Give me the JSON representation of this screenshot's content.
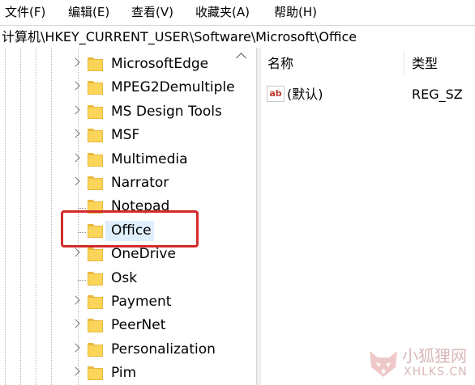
{
  "menu": [
    "文件(F)",
    "编辑(E)",
    "查看(V)",
    "收藏夹(A)",
    "帮助(H)"
  ],
  "address": "计算机\\HKEY_CURRENT_USER\\Software\\Microsoft\\Office",
  "tree": {
    "items": [
      {
        "label": "MicrosoftEdge",
        "expandable": true
      },
      {
        "label": "MPEG2Demultiple",
        "expandable": true
      },
      {
        "label": "MS Design Tools",
        "expandable": true
      },
      {
        "label": "MSF",
        "expandable": true
      },
      {
        "label": "Multimedia",
        "expandable": true
      },
      {
        "label": "Narrator",
        "expandable": true
      },
      {
        "label": "Notepad",
        "expandable": false
      },
      {
        "label": "Office",
        "expandable": false,
        "selected": true
      },
      {
        "label": "OneDrive",
        "expandable": true
      },
      {
        "label": "Osk",
        "expandable": false
      },
      {
        "label": "Payment",
        "expandable": true
      },
      {
        "label": "PeerNet",
        "expandable": true
      },
      {
        "label": "Personalization",
        "expandable": true
      },
      {
        "label": "Pim",
        "expandable": true
      }
    ]
  },
  "values": {
    "columns": {
      "name": "名称",
      "type": "类型"
    },
    "rows": [
      {
        "icon": "ab",
        "name": "(默认)",
        "type": "REG_SZ"
      }
    ]
  },
  "watermark": {
    "text": "小狐狸网",
    "domain": "XHLKS.CN"
  },
  "colors": {
    "highlight_box": "#d32a2a",
    "folder": "#fbd55a",
    "selection": "#dfeefc"
  }
}
